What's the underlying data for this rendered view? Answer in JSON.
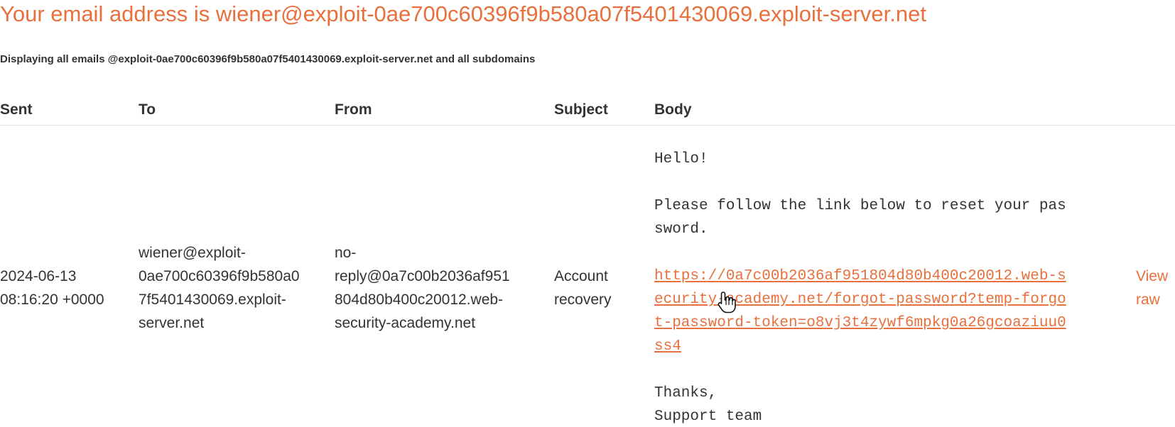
{
  "header": {
    "title": "Your email address is wiener@exploit-0ae700c60396f9b580a07f5401430069.exploit-server.net",
    "subtitle": "Displaying all emails @exploit-0ae700c60396f9b580a07f5401430069.exploit-server.net and all subdomains"
  },
  "table": {
    "columns": [
      "Sent",
      "To",
      "From",
      "Subject",
      "Body"
    ],
    "rows": [
      {
        "sent_lines": [
          "2024-06-13",
          "08:16:20 +0000"
        ],
        "to_lines": [
          "wiener@exploit-",
          "0ae700c60396f9b580a0",
          "7f5401430069.exploit-",
          "server.net"
        ],
        "from_lines": [
          "no-",
          "reply@0a7c00b2036af951",
          "804d80b400c20012.web-",
          "security-academy.net"
        ],
        "subject_lines": [
          "Account",
          "recovery"
        ],
        "body": {
          "greeting": "Hello!",
          "instruction_lines": [
            "Please follow the link below to reset your pas",
            "sword."
          ],
          "link_lines": [
            "https://0a7c00b2036af951804d80b400c20012.web-s",
            "ecurity-academy.net/forgot-password?temp-forgo",
            "t-password-token=o8vj3t4zywf6mpkg0a26gcoaziuu0",
            "ss4"
          ],
          "signoff_lines": [
            "Thanks,",
            "Support team"
          ]
        },
        "view_raw_lines": [
          "View",
          "raw"
        ]
      }
    ]
  },
  "colors": {
    "accent": "#e8703d",
    "text": "#333333",
    "rule": "#e4e4e4"
  },
  "icons": {
    "cursor": "hand-pointer-cursor"
  }
}
